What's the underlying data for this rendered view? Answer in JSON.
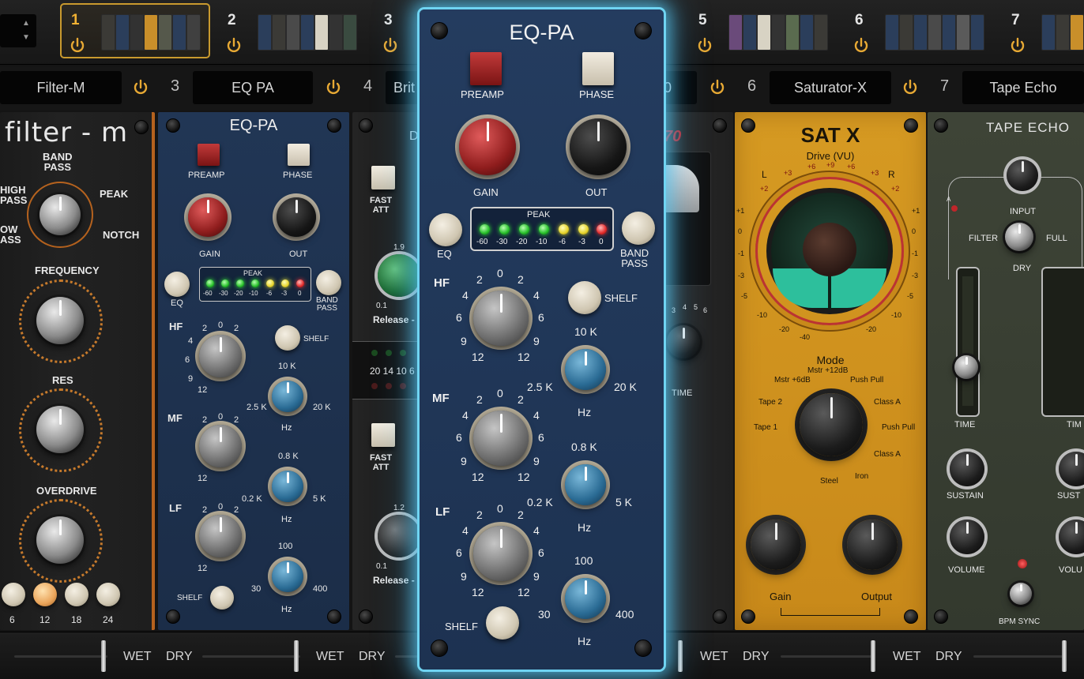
{
  "top_strip": {
    "slots": [
      {
        "num": "1",
        "selected": true
      },
      {
        "num": "2"
      },
      {
        "num": "3"
      },
      {
        "num": "5"
      },
      {
        "num": "6"
      },
      {
        "num": "7"
      }
    ]
  },
  "name_bar": {
    "slots": [
      {
        "num": "",
        "name": "Filter-M"
      },
      {
        "num": "3",
        "name": "EQ PA"
      },
      {
        "num": "4",
        "name": "Brit"
      },
      {
        "num": "0",
        "name": ""
      },
      {
        "num": "6",
        "name": "Saturator-X"
      },
      {
        "num": "7",
        "name": "Tape Echo"
      }
    ]
  },
  "filter_m": {
    "title": "filter - m",
    "mode_labels": {
      "band_pass": "BAND\nPASS",
      "high_pass": "HIGH\nPASS",
      "peak": "PEAK",
      "low_pass": "OW\nASS",
      "notch": "NOTCH"
    },
    "frequency": "FREQUENCY",
    "res": "RES",
    "overdrive": "OVERDRIVE",
    "slopes": [
      "6",
      "12",
      "18",
      "24"
    ]
  },
  "eq_pa_small": {
    "title": "EQ-PA",
    "preamp": "PREAMP",
    "phase": "PHASE",
    "gain": "GAIN",
    "out": "OUT",
    "peak": "PEAK",
    "eq": "EQ",
    "band_pass": "BAND\nPASS",
    "meter_scale": [
      "-60",
      "-30",
      "-20",
      "-10",
      "-6",
      "-3",
      "0"
    ],
    "hf": "HF",
    "mf": "MF",
    "lf": "LF",
    "shelf": "SHELF",
    "gain_scale": [
      "2",
      "0",
      "2",
      "4",
      "4",
      "6",
      "6",
      "9",
      "9",
      "12",
      "12"
    ],
    "hf_freq": [
      "10 K",
      "2.5 K",
      "20 K",
      "Hz"
    ],
    "mf_freq": [
      "0.8 K",
      "0.2 K",
      "5 K",
      "Hz"
    ],
    "lf_freq": [
      "100",
      "30",
      "400",
      "Hz"
    ]
  },
  "brit": {
    "title_frag": "D",
    "fast_att": "FAST\nATT",
    "release": "Release -",
    "scale_top": "1.9",
    "scale_low": "0.1",
    "scale_top2": "1.2",
    "leds": "20 14 10 6"
  },
  "featured": {
    "title": "EQ-PA",
    "preamp": "PREAMP",
    "phase": "PHASE",
    "gain": "GAIN",
    "out": "OUT",
    "peak": "PEAK",
    "eq": "EQ",
    "band_pass": "BAND\nPASS",
    "shelf_top": "SHELF",
    "meter_scale": [
      "-60",
      "-30",
      "-20",
      "-10",
      "-6",
      "-3",
      "0"
    ],
    "hf": "HF",
    "mf": "MF",
    "lf": "LF",
    "shelf_bottom": "SHELF",
    "hf_freq": [
      "10 K",
      "2.5 K",
      "20 K",
      "Hz"
    ],
    "mf_freq": [
      "0.8 K",
      "0.2 K",
      "5 K",
      "Hz"
    ],
    "lf_freq": [
      "100",
      "30",
      "400",
      "Hz"
    ],
    "gain_scale": [
      "2",
      "0",
      "2",
      "4",
      "4",
      "6",
      "6",
      "9",
      "9",
      "12",
      "12"
    ],
    "meter_leds": [
      "green",
      "green",
      "green",
      "green",
      "yellow",
      "yellow",
      "red"
    ]
  },
  "panel_70": {
    "title": "70",
    "time": "TIME",
    "scale": [
      "3",
      "4",
      "5",
      "6"
    ]
  },
  "sat_x": {
    "title": "SAT X",
    "drive": "Drive (VU)",
    "l": "L",
    "r": "R",
    "vu_left": [
      "+1",
      "0",
      "-1",
      "-3",
      "-5",
      "-10",
      "-20",
      "-40"
    ],
    "vu_right": [
      "+1",
      "0",
      "-1",
      "-3",
      "-5",
      "-10",
      "-20"
    ],
    "vu_top": [
      "+2",
      "+3",
      "+6",
      "+9",
      "+6",
      "+3",
      "+2"
    ],
    "mode": "Mode",
    "mode_items": [
      "Mstr +6dB",
      "Mstr +12dB",
      "Push Pull",
      "Tape 2",
      "Class A",
      "Tape 1",
      "Push Pull",
      "Class A",
      "Steel",
      "Iron"
    ],
    "gain": "Gain",
    "output": "Output"
  },
  "tape_echo": {
    "title": "TAPE ECHO",
    "input": "INPUT",
    "filter": "FILTER",
    "full": "FULL",
    "dry": "DRY",
    "time": "TIME",
    "time2": "TIM",
    "sustain": "SUSTAIN",
    "sustain2": "SUST",
    "volume": "VOLUME",
    "volume2": "VOLU",
    "bpm_sync": "BPM SYNC",
    "a": "A"
  },
  "bottom_bar": {
    "wet": "WET",
    "dry": "DRY"
  }
}
